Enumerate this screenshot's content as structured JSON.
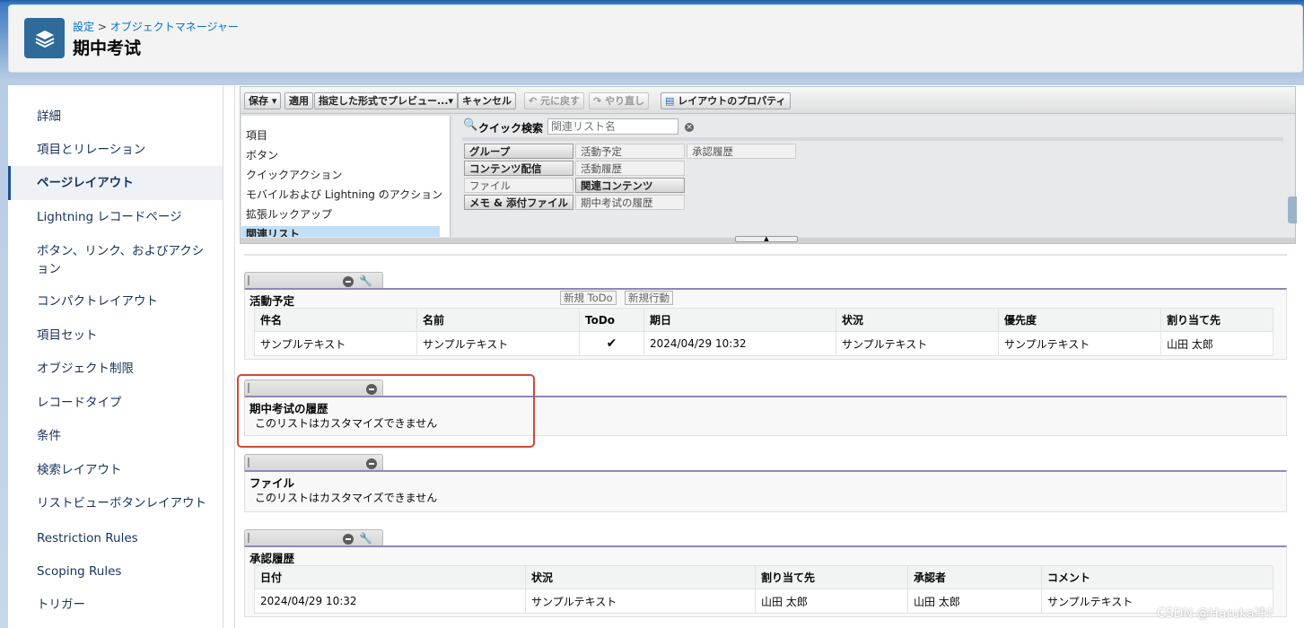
{
  "header": {
    "breadcrumb_setup": "設定",
    "breadcrumb_sep": " > ",
    "breadcrumb_object_manager": "オブジェクトマネージャー",
    "title": "期中考试",
    "icon": "layers-icon"
  },
  "sidebar": {
    "items": [
      {
        "label": "詳細"
      },
      {
        "label": "項目とリレーション"
      },
      {
        "label": "ページレイアウト",
        "active": true
      },
      {
        "label": "Lightning レコードページ"
      },
      {
        "label": "ボタン、リンク、およびアクション"
      },
      {
        "label": "コンパクトレイアウト"
      },
      {
        "label": "項目セット"
      },
      {
        "label": "オブジェクト制限"
      },
      {
        "label": "レコードタイプ"
      },
      {
        "label": "条件"
      },
      {
        "label": "検索レイアウト"
      },
      {
        "label": "リストビューボタンレイアウト"
      },
      {
        "label": "Restriction Rules"
      },
      {
        "label": "Scoping Rules"
      },
      {
        "label": "トリガー"
      }
    ]
  },
  "toolbar": {
    "save": "保存 ▾",
    "apply": "適用",
    "preview": "指定した形式でプレビュー...▾",
    "cancel": "キャンセル",
    "undo": "元に戻す",
    "redo": "やり直し",
    "properties": "レイアウトのプロパティ"
  },
  "palette": {
    "categories": [
      "項目",
      "ボタン",
      "クイックアクション",
      "モバイルおよび Lightning のアクション",
      "拡張ルックアップ",
      "関連リスト"
    ],
    "selected_category": "関連リスト",
    "quick_search_label": "クイック検索",
    "quick_search_placeholder": "関連リスト名",
    "items": {
      "group": "グループ",
      "activity_plan": "活動予定",
      "approval_history": "承認履歴",
      "content_delivery": "コンテンツ配信",
      "activity_history": "活動履歴",
      "file": "ファイル",
      "related_content": "関連コンテンツ",
      "notes_attachments": "メモ & 添付ファイル",
      "midterm_history": "期中考试の履歴"
    }
  },
  "related_lists": {
    "activity_plan": {
      "title": "活動予定",
      "new_todo": "新規 ToDo",
      "new_event": "新規行動",
      "columns": [
        "件名",
        "名前",
        "ToDo",
        "期日",
        "状況",
        "優先度",
        "割り当て先"
      ],
      "row": [
        "サンプルテキスト",
        "サンプルテキスト",
        "✔",
        "2024/04/29 10:32",
        "サンプルテキスト",
        "サンプルテキスト",
        "山田 太郎"
      ]
    },
    "midterm_history": {
      "title": "期中考试の履歴",
      "note": "このリストはカスタマイズできません"
    },
    "files": {
      "title": "ファイル",
      "note": "このリストはカスタマイズできません"
    },
    "approval_history": {
      "title": "承認履歴",
      "columns": [
        "日付",
        "状況",
        "割り当て先",
        "承認者",
        "コメント"
      ],
      "row": [
        "2024/04/29 10:32",
        "サンプルテキスト",
        "山田 太郎",
        "山田 太郎",
        "サンプルテキスト"
      ]
    }
  },
  "watermark": "CSDN @Haruka冲！",
  "colors": {
    "accent": "#1b5297",
    "highlight": "#d4473a",
    "section_border": "#8b89b9"
  }
}
